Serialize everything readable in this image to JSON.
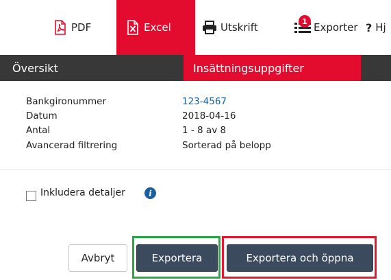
{
  "toolbar": {
    "pdf_label": "PDF",
    "excel_label": "Excel",
    "print_label": "Utskrift",
    "export_label": "Exporter",
    "export_badge": "1",
    "help_label": "Hj"
  },
  "tabs": {
    "overview_label": "Översikt",
    "deposit_label": "Insättningsuppgifter"
  },
  "details": [
    {
      "key": "Bankgironummer",
      "value": "123-4567"
    },
    {
      "key": "Datum",
      "value": "2018-04-16"
    },
    {
      "key": "Antal",
      "value": "1 - 8 av 8"
    },
    {
      "key": "Avancerad filtrering",
      "value": "Sorterad på belopp"
    }
  ],
  "options": {
    "include_details_label": "Inkludera detaljer",
    "include_details_checked": false
  },
  "actions": {
    "cancel_label": "Avbryt",
    "export_label": "Exportera",
    "export_open_label": "Exportera och öppna"
  },
  "colors": {
    "accent_red": "#e30b2e",
    "tab_bar": "#383838",
    "button_dark": "#3c4a5e",
    "highlight_green": "#28a745",
    "highlight_red": "#e3182e",
    "link_blue": "#1a5fa0"
  },
  "icons": {
    "pdf": "pdf-file-icon",
    "excel": "excel-file-icon",
    "print": "printer-icon",
    "export": "list-icon",
    "help": "question-mark-icon",
    "info": "info-icon"
  }
}
